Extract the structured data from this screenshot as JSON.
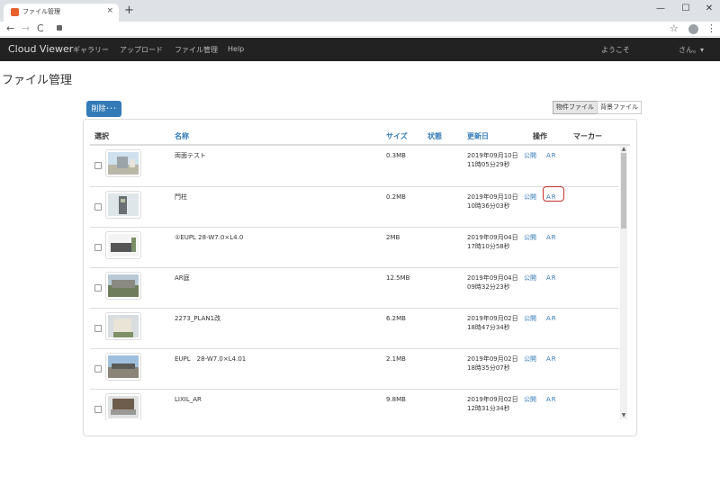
{
  "browser": {
    "tab_title": "ファイル管理",
    "close_glyph": "×",
    "new_tab_glyph": "+",
    "url": "",
    "window_min": "—",
    "window_max": "☐",
    "window_close": "✕",
    "back_glyph": "←",
    "forward_glyph": "→",
    "reload_glyph": "C",
    "star_glyph": "☆",
    "menu_glyph": "⋮"
  },
  "navbar": {
    "brand": "Cloud Viewer",
    "items": [
      "ギャラリー",
      "アップロード",
      "ファイル管理",
      "Help"
    ],
    "welcome": "ようこそ",
    "user_menu": "さん。▾"
  },
  "page": {
    "title": "ファイル管理",
    "delete_button": "削除･･･",
    "toggle": [
      "物件ファイル",
      "背景ファイル"
    ]
  },
  "table": {
    "headers": {
      "select": "選択",
      "name": "名称",
      "size": "サイズ",
      "status": "状態",
      "updated": "更新日",
      "ops": "操作",
      "marker": "マーカー"
    },
    "publish_label": "公開",
    "ar_label": "AR",
    "rows": [
      {
        "name": "両面テスト",
        "size": "0.3MB",
        "date": "2019年09月10日",
        "time": "11時05分29秒"
      },
      {
        "name": "門柱",
        "size": "0.2MB",
        "date": "2019年09月10日",
        "time": "10時36分03秒"
      },
      {
        "name": "①EUPL 28-W7.0×L4.0",
        "size": "2MB",
        "date": "2019年09月04日",
        "time": "17時10分58秒"
      },
      {
        "name": "AR庭",
        "size": "12.5MB",
        "date": "2019年09月04日",
        "time": "09時32分23秒"
      },
      {
        "name": "2273_PLAN1改",
        "size": "6.2MB",
        "date": "2019年09月02日",
        "time": "18時47分34秒"
      },
      {
        "name": "EUPL　28-W7.0×L4.01",
        "size": "2.1MB",
        "date": "2019年09月02日",
        "time": "18時35分07秒"
      },
      {
        "name": "LIXIL_AR",
        "size": "9.8MB",
        "date": "2019年09月02日",
        "time": "12時31分34秒"
      }
    ]
  },
  "colors": {
    "navbar_bg": "#222222",
    "primary": "#337ab7",
    "link": "#337ab7",
    "highlight_outline": "#c9302c"
  }
}
